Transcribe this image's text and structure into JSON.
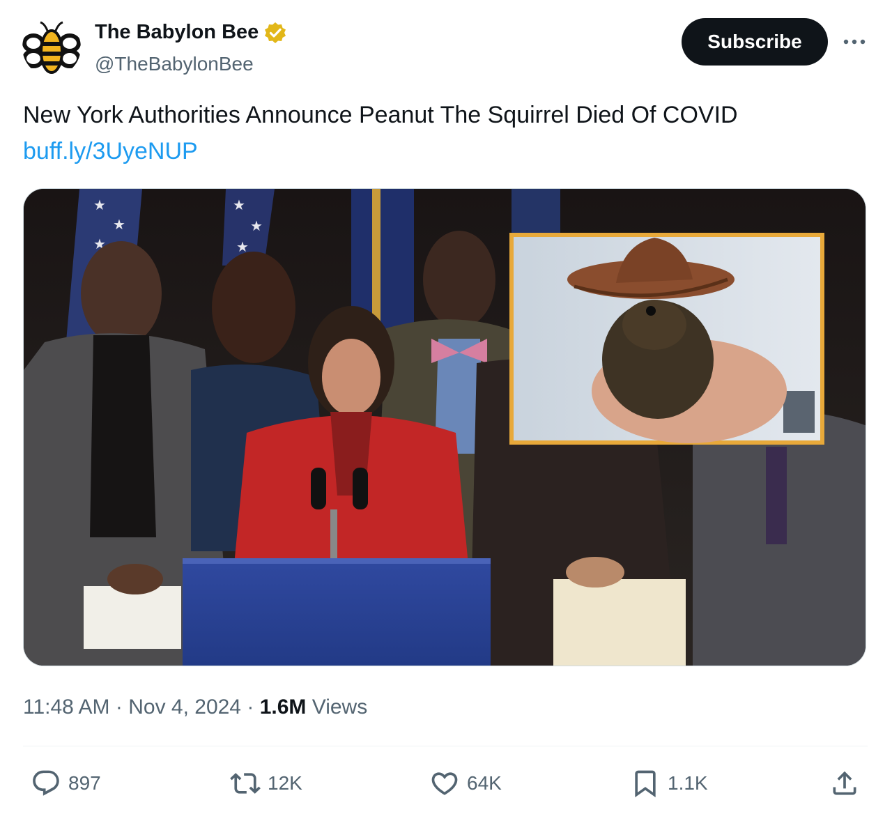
{
  "account": {
    "display_name": "The Babylon Bee",
    "handle": "@TheBabylonBee",
    "verified_icon": "gold-verified-badge-icon",
    "avatar_icon": "babylon-bee-logo"
  },
  "header": {
    "subscribe_label": "Subscribe",
    "more_icon": "more-horizontal-icon"
  },
  "tweet": {
    "text": "New York Authorities Announce Peanut The Squirrel Died Of COVID",
    "link": "buff.ly/3UyeNUP"
  },
  "meta": {
    "time": "11:48 AM",
    "separator": "·",
    "date": "Nov 4, 2024",
    "views_count": "1.6M",
    "views_label": "Views"
  },
  "actions": {
    "replies": "897",
    "reposts": "12K",
    "likes": "64K",
    "bookmarks": "1.1K",
    "icons": [
      "reply-icon",
      "repost-icon",
      "like-icon",
      "bookmark-icon",
      "share-icon"
    ]
  },
  "colors": {
    "text": "#0f1419",
    "secondary": "#536471",
    "link": "#1d9bf0",
    "subscribe_bg": "#0f1419",
    "verified": "#e2b719",
    "inset_border": "#e8a93a"
  }
}
